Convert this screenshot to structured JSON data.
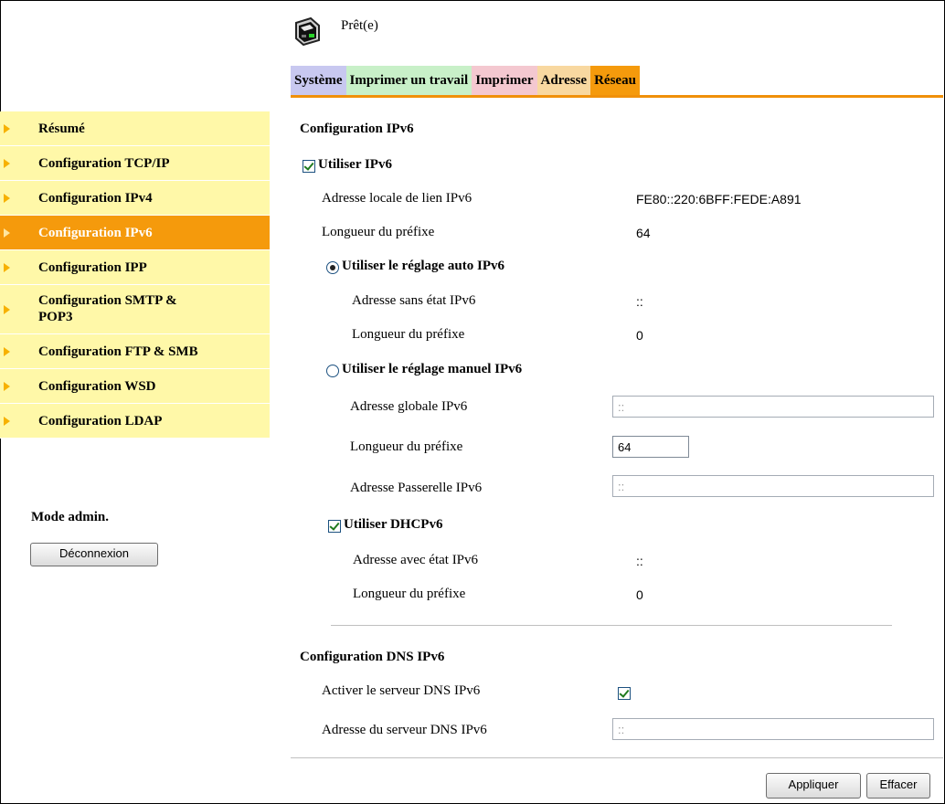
{
  "header": {
    "status": "Prêt(e)"
  },
  "tabs": [
    {
      "label": "Système",
      "color": "#c8c8f0"
    },
    {
      "label": "Imprimer un travail",
      "color": "#c8f0c8"
    },
    {
      "label": "Imprimer",
      "color": "#f4c8d0"
    },
    {
      "label": "Adresse",
      "color": "#f8d8a0"
    },
    {
      "label": "Réseau",
      "color": "#f59a0c",
      "active": true
    }
  ],
  "sidebar": {
    "items": [
      {
        "label": "Résumé"
      },
      {
        "label": "Configuration TCP/IP"
      },
      {
        "label": "Configuration IPv4"
      },
      {
        "label": "Configuration IPv6",
        "active": true
      },
      {
        "label": "Configuration IPP"
      },
      {
        "label": "Configuration SMTP &",
        "label2": "POP3"
      },
      {
        "label": "Configuration FTP & SMB"
      },
      {
        "label": "Configuration WSD"
      },
      {
        "label": "Configuration LDAP"
      }
    ],
    "admin_title": "Mode admin.",
    "logout_label": "Déconnexion"
  },
  "main": {
    "ipv6_heading": "Configuration IPv6",
    "use_ipv6": {
      "label": "Utiliser IPv6",
      "checked": true
    },
    "link_local_label": "Adresse locale de lien IPv6",
    "link_local_value": "FE80::220:6BFF:FEDE:A891",
    "prefix_label": "Longueur du préfixe",
    "prefix_value": "64",
    "auto": {
      "label": "Utiliser le réglage auto IPv6",
      "selected": true,
      "stateless_label": "Adresse sans état IPv6",
      "stateless_value": "::",
      "prefix_label": "Longueur du préfixe",
      "prefix_value": "0"
    },
    "manual": {
      "label": "Utiliser le réglage manuel IPv6",
      "selected": false,
      "global_label": "Adresse globale IPv6",
      "global_value": "::",
      "prefix_label": "Longueur du préfixe",
      "prefix_value": "64",
      "gateway_label": "Adresse Passerelle IPv6",
      "gateway_value": "::"
    },
    "dhcp": {
      "label": "Utiliser DHCPv6",
      "checked": true,
      "stateful_label": "Adresse avec état IPv6",
      "stateful_value": "::",
      "prefix_label": "Longueur du préfixe",
      "prefix_value": "0"
    },
    "dns_heading": "Configuration DNS IPv6",
    "dns_enable_label": "Activer le serveur DNS IPv6",
    "dns_enable_checked": true,
    "dns_server_label": "Adresse du serveur DNS IPv6",
    "dns_server_value": "::",
    "apply_label": "Appliquer",
    "clear_label": "Effacer"
  }
}
